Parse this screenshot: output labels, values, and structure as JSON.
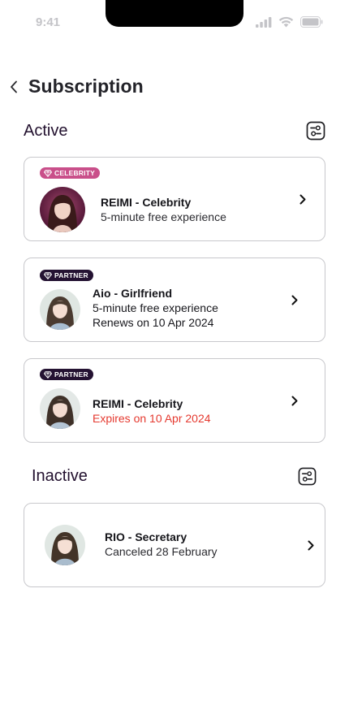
{
  "status_bar": {
    "time": "9:41"
  },
  "header": {
    "title": "Subscription"
  },
  "sections": {
    "active": {
      "title": "Active"
    },
    "inactive": {
      "title": "Inactive"
    }
  },
  "active_cards": [
    {
      "badge": "CELEBRITY",
      "name": "REIMI - Celebrity",
      "lines": [
        "5-minute free experience"
      ]
    },
    {
      "badge": "PARTNER",
      "name": "Aio - Girlfriend",
      "lines": [
        "5-minute free experience",
        "Renews on 10 Apr 2024"
      ]
    },
    {
      "badge": "PARTNER",
      "name": "REIMI - Celebrity",
      "lines": [
        "Expires on 10 Apr 2024"
      ]
    }
  ],
  "inactive_cards": [
    {
      "name": "RIO - Secretary",
      "lines": [
        "Canceled 28 February"
      ]
    }
  ],
  "colors": {
    "celebrity_badge": "#c94f8a",
    "partner_badge": "#241232",
    "expiry_text": "#e5392f",
    "section_title": "#22102e"
  }
}
